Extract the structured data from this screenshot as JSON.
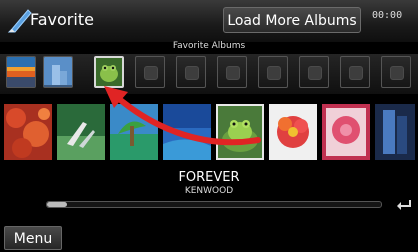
{
  "header": {
    "title": "Favorite",
    "load_more_label": "Load More Albums",
    "clock": "00:00"
  },
  "favorites": {
    "label": "Favorite Albums",
    "slots": [
      "sunset-art",
      "building-art",
      "frog-art",
      "empty",
      "empty",
      "empty",
      "empty",
      "empty",
      "empty",
      "empty",
      "empty"
    ]
  },
  "albums": [
    "red-leaves-art",
    "deck-chair-art",
    "tropical-art",
    "blue-sky-art",
    "frog-art",
    "flower-art",
    "pink-flower-art",
    "blue-figure-art"
  ],
  "now_playing": {
    "title": "FOREVER",
    "artist": "KENWOOD",
    "progress": 0.06
  },
  "bottom": {
    "menu_label": "Menu"
  },
  "colors": {
    "accent_arrow": "#e02424"
  }
}
